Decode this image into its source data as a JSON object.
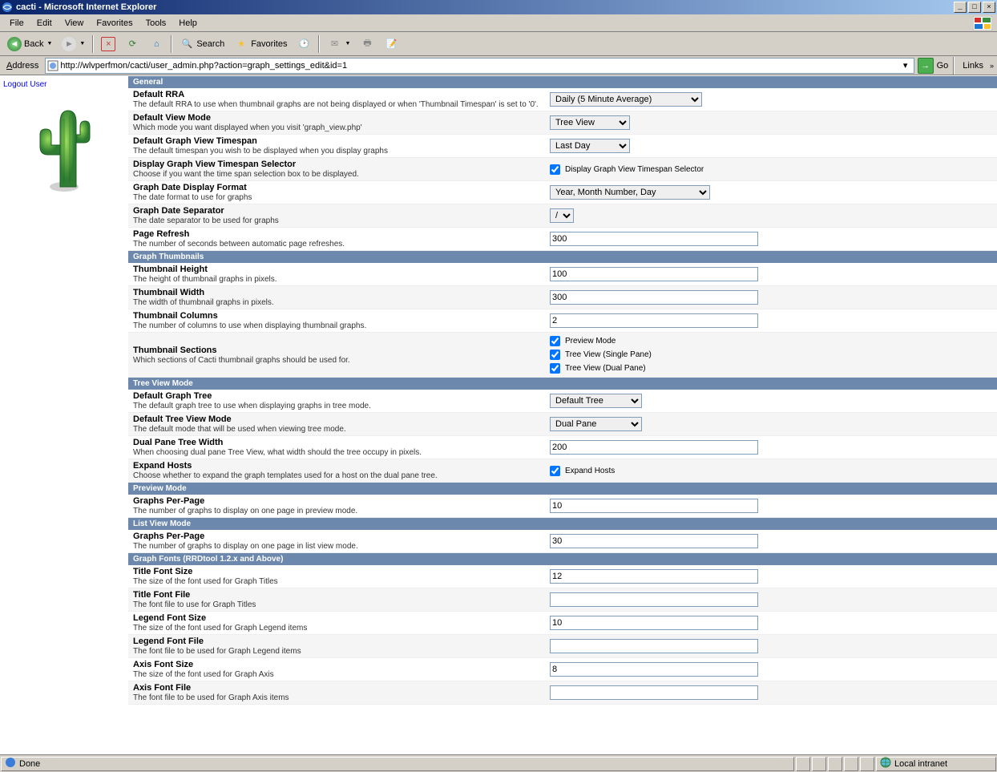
{
  "window": {
    "title": "cacti - Microsoft Internet Explorer"
  },
  "menubar": {
    "file": "File",
    "edit": "Edit",
    "view": "View",
    "favorites": "Favorites",
    "tools": "Tools",
    "help": "Help"
  },
  "toolbar": {
    "back": "Back",
    "search": "Search",
    "favorites": "Favorites"
  },
  "addressbar": {
    "label": "Address",
    "url": "http://wlvperfmon/cacti/user_admin.php?action=graph_settings_edit&id=1",
    "go": "Go",
    "links": "Links"
  },
  "sidebar": {
    "logout": "Logout User"
  },
  "sections": {
    "general": "General",
    "thumbnails": "Graph Thumbnails",
    "tree": "Tree View Mode",
    "preview": "Preview Mode",
    "listview": "List View Mode",
    "fonts": "Graph Fonts (RRDtool 1.2.x and Above)"
  },
  "rows": {
    "default_rra": {
      "title": "Default RRA",
      "desc": "The default RRA to use when thumbnail graphs are not being displayed or when 'Thumbnail Timespan' is set to '0'.",
      "value": "Daily (5 Minute Average)"
    },
    "default_view_mode": {
      "title": "Default View Mode",
      "desc": "Which mode you want displayed when you visit 'graph_view.php'",
      "value": "Tree View"
    },
    "default_timespan": {
      "title": "Default Graph View Timespan",
      "desc": "The default timespan you wish to be displayed when you display graphs",
      "value": "Last Day"
    },
    "display_timespan_selector": {
      "title": "Display Graph View Timespan Selector",
      "desc": "Choose if you want the time span selection box to be displayed.",
      "cb_label": "Display Graph View Timespan Selector",
      "checked": true
    },
    "date_format": {
      "title": "Graph Date Display Format",
      "desc": "The date format to use for graphs",
      "value": "Year, Month Number, Day"
    },
    "date_separator": {
      "title": "Graph Date Separator",
      "desc": "The date separator to be used for graphs",
      "value": "/"
    },
    "page_refresh": {
      "title": "Page Refresh",
      "desc": "The number of seconds between automatic page refreshes.",
      "value": "300"
    },
    "thumb_height": {
      "title": "Thumbnail Height",
      "desc": "The height of thumbnail graphs in pixels.",
      "value": "100"
    },
    "thumb_width": {
      "title": "Thumbnail Width",
      "desc": "The width of thumbnail graphs in pixels.",
      "value": "300"
    },
    "thumb_columns": {
      "title": "Thumbnail Columns",
      "desc": "The number of columns to use when displaying thumbnail graphs.",
      "value": "2"
    },
    "thumb_sections": {
      "title": "Thumbnail Sections",
      "desc": "Which sections of Cacti thumbnail graphs should be used for.",
      "cb1": "Preview Mode",
      "cb2": "Tree View (Single Pane)",
      "cb3": "Tree View (Dual Pane)"
    },
    "default_tree": {
      "title": "Default Graph Tree",
      "desc": "The default graph tree to use when displaying graphs in tree mode.",
      "value": "Default Tree"
    },
    "default_tree_mode": {
      "title": "Default Tree View Mode",
      "desc": "The default mode that will be used when viewing tree mode.",
      "value": "Dual Pane"
    },
    "dual_pane_width": {
      "title": "Dual Pane Tree Width",
      "desc": "When choosing dual pane Tree View, what width should the tree occupy in pixels.",
      "value": "200"
    },
    "expand_hosts": {
      "title": "Expand Hosts",
      "desc": "Choose whether to expand the graph templates used for a host on the dual pane tree.",
      "cb_label": "Expand Hosts",
      "checked": true
    },
    "preview_gpp": {
      "title": "Graphs Per-Page",
      "desc": "The number of graphs to display on one page in preview mode.",
      "value": "10"
    },
    "list_gpp": {
      "title": "Graphs Per-Page",
      "desc": "The number of graphs to display on one page in list view mode.",
      "value": "30"
    },
    "title_font_size": {
      "title": "Title Font Size",
      "desc": "The size of the font used for Graph Titles",
      "value": "12"
    },
    "title_font_file": {
      "title": "Title Font File",
      "desc": "The font file to use for Graph Titles",
      "value": ""
    },
    "legend_font_size": {
      "title": "Legend Font Size",
      "desc": "The size of the font used for Graph Legend items",
      "value": "10"
    },
    "legend_font_file": {
      "title": "Legend Font File",
      "desc": "The font file to be used for Graph Legend items",
      "value": ""
    },
    "axis_font_size": {
      "title": "Axis Font Size",
      "desc": "The size of the font used for Graph Axis",
      "value": "8"
    },
    "axis_font_file": {
      "title": "Axis Font File",
      "desc": "The font file to be used for Graph Axis items",
      "value": ""
    }
  },
  "statusbar": {
    "done": "Done",
    "zone": "Local intranet"
  }
}
